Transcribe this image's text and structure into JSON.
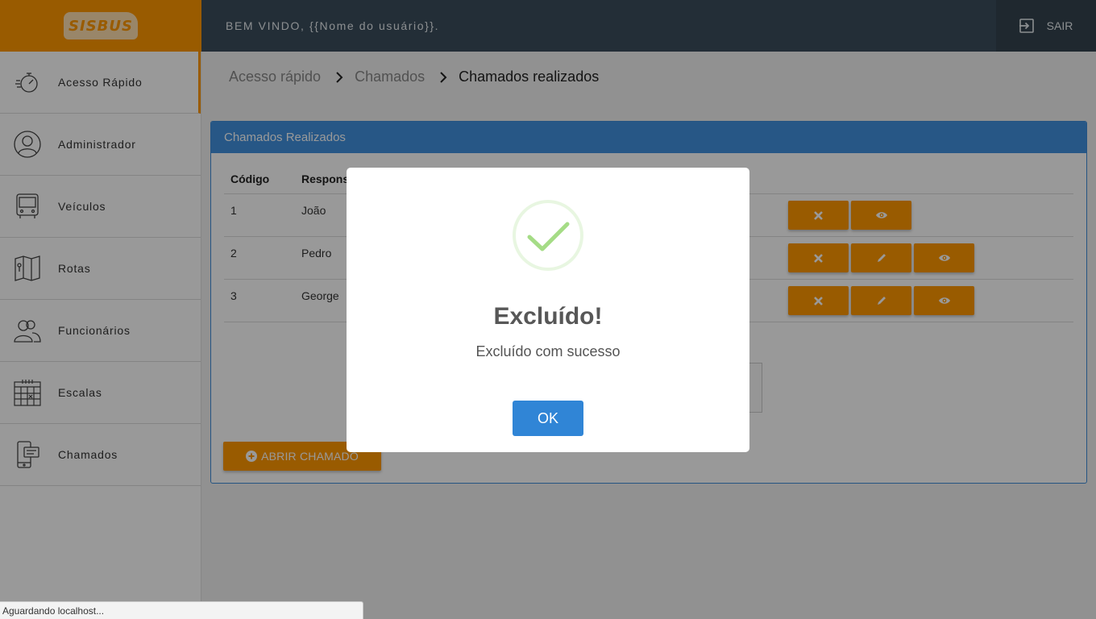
{
  "header": {
    "logo_text": "SISBUS",
    "welcome": "BEM VINDO, {{Nome do usuário}}.",
    "logout_label": "SAIR"
  },
  "sidebar": {
    "items": [
      {
        "label": "Acesso Rápido",
        "icon": "stopwatch-icon",
        "active": true
      },
      {
        "label": "Administrador",
        "icon": "admin-user-icon"
      },
      {
        "label": "Veículos",
        "icon": "bus-icon"
      },
      {
        "label": "Rotas",
        "icon": "map-icon"
      },
      {
        "label": "Funcionários",
        "icon": "people-icon"
      },
      {
        "label": "Escalas",
        "icon": "calendar-icon"
      },
      {
        "label": "Chamados",
        "icon": "phone-ticket-icon"
      }
    ]
  },
  "breadcrumb": {
    "items": [
      "Acesso rápido",
      "Chamados",
      "Chamados realizados"
    ]
  },
  "card": {
    "title": "Chamados Realizados",
    "columns": [
      "Código",
      "Responsa"
    ],
    "rows": [
      {
        "code": "1",
        "responsible": "João",
        "actions": [
          "delete",
          "view"
        ]
      },
      {
        "code": "2",
        "responsible": "Pedro",
        "actions": [
          "delete",
          "edit",
          "view"
        ]
      },
      {
        "code": "3",
        "responsible": "George",
        "actions": [
          "delete",
          "edit",
          "view"
        ]
      }
    ],
    "open_button_label": "ABRIR CHAMADO"
  },
  "modal": {
    "title": "Excluído!",
    "text": "Excluído com sucesso",
    "ok_label": "OK"
  },
  "status_bar": "Aguardando localhost...",
  "colors": {
    "accent": "#ff9800",
    "topbar": "#3b4d5c",
    "card_header": "#4192e0",
    "ok_button": "#3085d6",
    "success": "#a5dc86"
  }
}
